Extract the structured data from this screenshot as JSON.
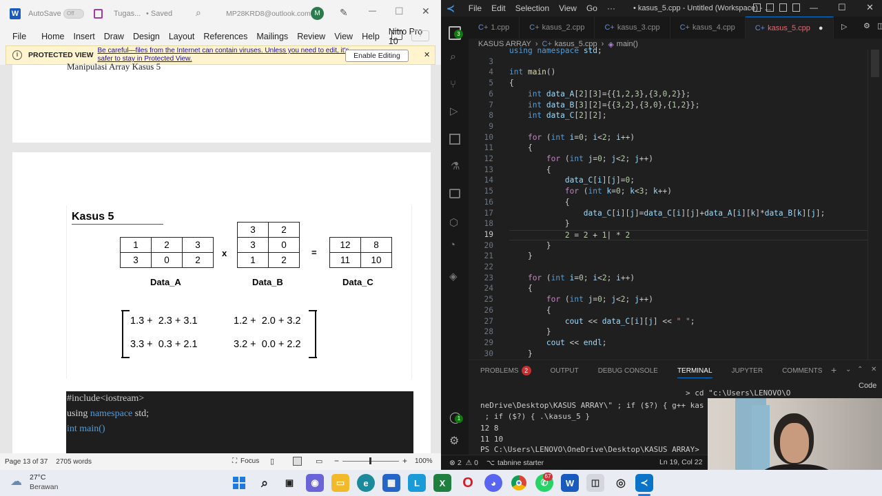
{
  "word": {
    "app_icon": "W",
    "autosave_label": "AutoSave",
    "autosave_state": "Off",
    "doc_title": "Tugas...",
    "saved_status": "• Saved",
    "account_email": "MP28KRD8@outlook.com",
    "avatar_initial": "M",
    "ribbon_tabs": [
      "File",
      "Home",
      "Insert",
      "Draw",
      "Design",
      "Layout",
      "References",
      "Mailings",
      "Review",
      "View",
      "Help",
      "Nitro Pro 10"
    ],
    "protected_view": {
      "label": "PROTECTED VIEW",
      "message_line1": "Be careful—files from the Internet can contain viruses. Unless you need to edit, it's",
      "message_line2": "safer to stay in Protected View.",
      "button": "Enable Editing"
    },
    "page1_text": "Manipulasi Array Kasus 5",
    "figure": {
      "heading": "Kasus 5",
      "matrix_a": [
        [
          "1",
          "2",
          "3"
        ],
        [
          "3",
          "0",
          "2"
        ]
      ],
      "matrix_b": [
        [
          "3",
          "2"
        ],
        [
          "3",
          "0"
        ],
        [
          "1",
          "2"
        ]
      ],
      "matrix_c": [
        [
          "12",
          "8"
        ],
        [
          "11",
          "10"
        ]
      ],
      "times": "x",
      "equals": "=",
      "label_a": "Data_A",
      "label_b": "Data_B",
      "label_c": "Data_C",
      "calc": [
        [
          "1.3 +  2.3 + 3.1",
          "1.2 +  2.0 + 3.2"
        ],
        [
          "3.3 +  0.3 + 2.1",
          "3.2 +  0.0 + 2.2"
        ]
      ]
    },
    "code_block": [
      "#include<iostream>",
      "using namespace std;",
      "",
      "int main()"
    ],
    "status": {
      "page": "Page 13 of 37",
      "words": "2705 words",
      "focus": "Focus",
      "zoom": "100%"
    }
  },
  "vscode": {
    "menu": [
      "File",
      "Edit",
      "Selection",
      "View",
      "Go",
      "···"
    ],
    "title": "• kasus_5.cpp - Untitled (Workspace) - ...",
    "tabs": [
      {
        "label": "1.cpp",
        "active": false
      },
      {
        "label": "kasus_2.cpp",
        "active": false
      },
      {
        "label": "kasus_3.cpp",
        "active": false
      },
      {
        "label": "kasus_4.cpp",
        "active": false
      },
      {
        "label": "kasus_5.cpp",
        "active": true
      }
    ],
    "breadcrumb": [
      "KASUS ARRAY",
      "kasus_5.cpp",
      "main()"
    ],
    "badge_count": "3",
    "lines": [
      {
        "n": "",
        "html": "<span class='kw'>using</span> <span class='kw'>namespace</span> <span class='var'>std</span>;"
      },
      {
        "n": "3",
        "html": ""
      },
      {
        "n": "4",
        "html": "<span class='ty'>int</span> <span class='fn'>main</span>()"
      },
      {
        "n": "5",
        "html": "{"
      },
      {
        "n": "6",
        "html": "    <span class='ty'>int</span> <span class='var'>data_A</span>[<span class='nm'>2</span>][<span class='nm'>3</span>]={{<span class='nm'>1</span>,<span class='nm'>2</span>,<span class='nm'>3</span>},{<span class='nm'>3</span>,<span class='nm'>0</span>,<span class='nm'>2</span>}};"
      },
      {
        "n": "7",
        "html": "    <span class='ty'>int</span> <span class='var'>data_B</span>[<span class='nm'>3</span>][<span class='nm'>2</span>]={{<span class='nm'>3</span>,<span class='nm'>2</span>},{<span class='nm'>3</span>,<span class='nm'>0</span>},{<span class='nm'>1</span>,<span class='nm'>2</span>}};"
      },
      {
        "n": "8",
        "html": "    <span class='ty'>int</span> <span class='var'>data_C</span>[<span class='nm'>2</span>][<span class='nm'>2</span>];"
      },
      {
        "n": "9",
        "html": ""
      },
      {
        "n": "10",
        "html": "    <span class='ctl'>for</span> (<span class='ty'>int</span> <span class='var'>i</span>=<span class='nm'>0</span>; <span class='var'>i</span>&lt;<span class='nm'>2</span>; <span class='var'>i</span>++)"
      },
      {
        "n": "11",
        "html": "    {"
      },
      {
        "n": "12",
        "html": "        <span class='ctl'>for</span> (<span class='ty'>int</span> <span class='var'>j</span>=<span class='nm'>0</span>; <span class='var'>j</span>&lt;<span class='nm'>2</span>; <span class='var'>j</span>++)"
      },
      {
        "n": "13",
        "html": "        {"
      },
      {
        "n": "14",
        "html": "            <span class='var'>data_C</span>[<span class='var'>i</span>][<span class='var'>j</span>]=<span class='nm'>0</span>;"
      },
      {
        "n": "15",
        "html": "            <span class='ctl'>for</span> (<span class='ty'>int</span> <span class='var'>k</span>=<span class='nm'>0</span>; <span class='var'>k</span>&lt;<span class='nm'>3</span>; <span class='var'>k</span>++)"
      },
      {
        "n": "16",
        "html": "            {"
      },
      {
        "n": "17",
        "html": "                <span class='var'>data_C</span>[<span class='var'>i</span>][<span class='var'>j</span>]=<span class='var'>data_C</span>[<span class='var'>i</span>][<span class='var'>j</span>]+<span class='var'>data_A</span>[<span class='var'>i</span>][<span class='var'>k</span>]*<span class='var'>data_B</span>[<span class='var'>k</span>][<span class='var'>j</span>];"
      },
      {
        "n": "18",
        "html": "            }"
      },
      {
        "n": "19",
        "html": "            <span class='nm'>2</span> = <span class='nm'>2</span> + <span class='nm'>1</span>| * <span class='nm'>2</span>"
      },
      {
        "n": "20",
        "html": "        }"
      },
      {
        "n": "21",
        "html": "    }"
      },
      {
        "n": "22",
        "html": ""
      },
      {
        "n": "23",
        "html": "    <span class='ctl'>for</span> (<span class='ty'>int</span> <span class='var'>i</span>=<span class='nm'>0</span>; <span class='var'>i</span>&lt;<span class='nm'>2</span>; <span class='var'>i</span>++)"
      },
      {
        "n": "24",
        "html": "    {"
      },
      {
        "n": "25",
        "html": "        <span class='ctl'>for</span> (<span class='ty'>int</span> <span class='var'>j</span>=<span class='nm'>0</span>; <span class='var'>j</span>&lt;<span class='nm'>2</span>; <span class='var'>j</span>++)"
      },
      {
        "n": "26",
        "html": "        {"
      },
      {
        "n": "27",
        "html": "            <span class='var'>cout</span> &lt;&lt; <span class='var'>data_C</span>[<span class='var'>i</span>][<span class='var'>j</span>] &lt;&lt; <span class='str'>\" \"</span>;"
      },
      {
        "n": "28",
        "html": "        }"
      },
      {
        "n": "29",
        "html": "        <span class='var'>cout</span> &lt;&lt; <span class='var'>endl</span>;"
      },
      {
        "n": "30",
        "html": "    }"
      }
    ],
    "active_line": "19",
    "panel_tabs": [
      "PROBLEMS",
      "OUTPUT",
      "DEBUG CONSOLE",
      "TERMINAL",
      "JUPYTER",
      "COMMENTS"
    ],
    "problems_count": "2",
    "terminal": [
      "                                             > cd \"c:\\Users\\LENOVO\\O",
      "neDrive\\Desktop\\KASUS ARRAY\\\" ; if ($?) { g++ kas",
      " ; if ($?) { .\\kasus_5 }",
      "12 8",
      "11 10",
      "PS C:\\Users\\LENOVO\\OneDrive\\Desktop\\KASUS ARRAY> "
    ],
    "code_label": "Code",
    "status": {
      "errors": "2",
      "warnings": "0",
      "tabnine": "tabnine starter",
      "position": "Ln 19, Col 22"
    }
  },
  "taskbar": {
    "weather_temp": "27°C",
    "weather_desc": "Berawan",
    "edge_badge": "67"
  }
}
